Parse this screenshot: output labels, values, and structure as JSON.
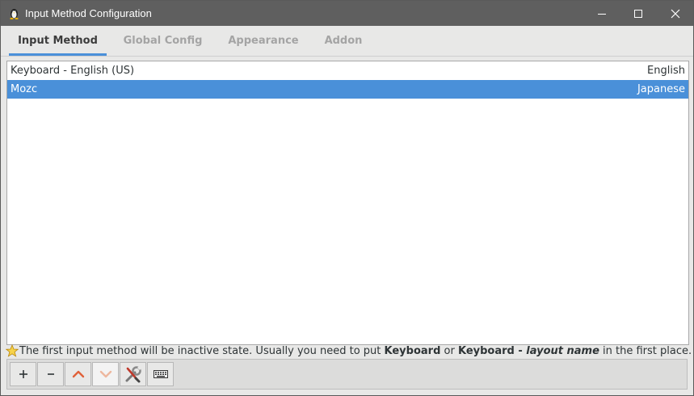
{
  "window": {
    "title": "Input Method Configuration",
    "app_icon": "penguin-icon"
  },
  "titlebar_buttons": [
    {
      "name": "minimize-button",
      "icon": "minimize-icon"
    },
    {
      "name": "maximize-button",
      "icon": "maximize-icon"
    },
    {
      "name": "close-button",
      "icon": "close-icon"
    }
  ],
  "tabs": [
    {
      "label": "Input Method",
      "active": true
    },
    {
      "label": "Global Config",
      "active": false
    },
    {
      "label": "Appearance",
      "active": false
    },
    {
      "label": "Addon",
      "active": false
    }
  ],
  "input_methods": [
    {
      "name": "Keyboard - English (US)",
      "language": "English",
      "selected": false
    },
    {
      "name": "Mozc",
      "language": "Japanese",
      "selected": true
    }
  ],
  "hint": {
    "icon": "star-icon",
    "part1": "The first input method will be inactive state. Usually you need to put ",
    "bold1": "Keyboard",
    "part2": " or ",
    "bold2": "Keyboard - ",
    "italic": "layout name",
    "part3": " in the first place."
  },
  "toolbar": [
    {
      "name": "add-button",
      "icon": "plus-icon"
    },
    {
      "name": "remove-button",
      "icon": "minus-icon"
    },
    {
      "name": "move-up-button",
      "icon": "chevron-up-icon"
    },
    {
      "name": "move-down-button",
      "icon": "chevron-down-icon"
    },
    {
      "name": "configure-button",
      "icon": "wrench-screwdriver-icon"
    },
    {
      "name": "keyboard-layout-button",
      "icon": "keyboard-icon"
    }
  ],
  "colors": {
    "accent": "#4a90d9",
    "titlebar": "#5f5f5f",
    "arrow": "#e0613a"
  }
}
